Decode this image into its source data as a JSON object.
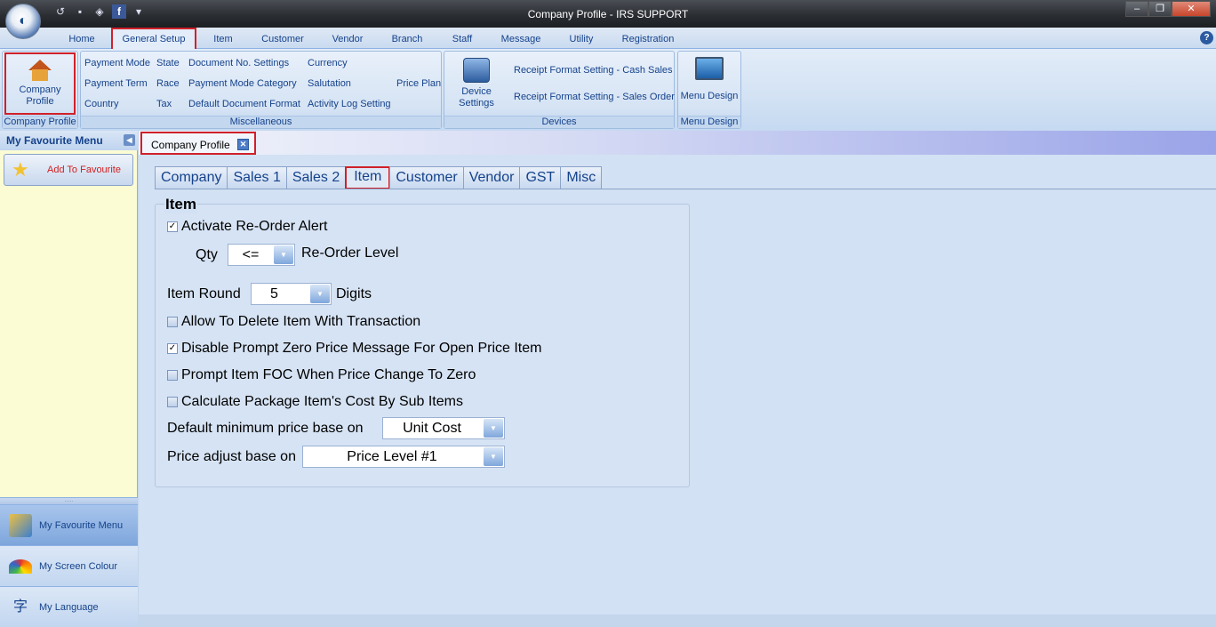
{
  "window": {
    "title": "Company Profile - IRS SUPPORT"
  },
  "ribbon_tabs": [
    "Home",
    "General Setup",
    "Item",
    "Customer",
    "Vendor",
    "Branch",
    "Staff",
    "Message",
    "Utility",
    "Registration"
  ],
  "ribbon": {
    "company_profile": {
      "button": "Company Profile",
      "group": "Company Profile"
    },
    "misc": {
      "col1": [
        "Payment Mode",
        "Payment Term",
        "Country"
      ],
      "col2": [
        "State",
        "Race",
        "Tax"
      ],
      "col3": [
        "Document No. Settings",
        "Payment Mode Category",
        "Default Document Format"
      ],
      "col4": [
        "Currency",
        "Salutation",
        "Activity Log Setting"
      ],
      "price_plan": "Price Plan",
      "group": "Miscellaneous"
    },
    "devices": {
      "device_settings": "Device Settings",
      "receipt_cash": "Receipt Format Setting - Cash  Sales",
      "receipt_sales": "Receipt Format Setting - Sales Order",
      "group": "Devices"
    },
    "menu_design": {
      "button": "Menu Design",
      "group": "Menu Design"
    }
  },
  "left_panel": {
    "title": "My Favourite Menu",
    "add_favourite": "Add To Favourite",
    "nav": [
      "My Favourite Menu",
      "My Screen Colour",
      "My Language"
    ]
  },
  "doc_tab": {
    "label": "Company Profile"
  },
  "inner_tabs": [
    "Company",
    "Sales 1",
    "Sales 2",
    "Item",
    "Customer",
    "Vendor",
    "GST",
    "Misc"
  ],
  "item_panel": {
    "title": "Item",
    "reorder_alert": {
      "label": "Activate Re-Order Alert",
      "checked": true
    },
    "qty_label": "Qty",
    "qty_operator": "<=",
    "reorder_level_label": "Re-Order Level",
    "item_round_label": "Item Round",
    "item_round_value": "5",
    "digits_label": "Digits",
    "allow_delete": {
      "label": "Allow To Delete Item With Transaction",
      "checked": false
    },
    "disable_prompt_zero": {
      "label": "Disable Prompt Zero Price Message For Open Price Item",
      "checked": true
    },
    "prompt_foc": {
      "label": "Prompt Item FOC When Price Change To Zero",
      "checked": false
    },
    "calc_package": {
      "label": "Calculate Package Item's Cost By Sub Items",
      "checked": false
    },
    "default_min_price_label": "Default minimum price base on",
    "default_min_price_value": "Unit Cost",
    "price_adjust_label": "Price adjust base on",
    "price_adjust_value": "Price Level #1"
  }
}
